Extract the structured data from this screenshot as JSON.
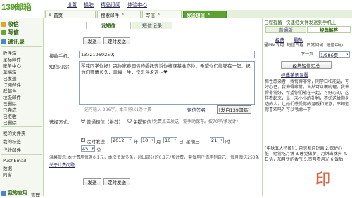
{
  "brand": {
    "logo": "139邮箱"
  },
  "topnav": [
    "设置",
    "换肤",
    "精品订阅",
    "体验中心"
  ],
  "tabs": [
    {
      "label": "首页",
      "active": false
    },
    {
      "label": "搜索邮件",
      "active": false
    },
    {
      "label": "写信",
      "active": false
    },
    {
      "label": "发送短信",
      "active": true
    }
  ],
  "sidebar": {
    "main": [
      "收信",
      "写信",
      "通讯录"
    ],
    "items1": [
      "收件箱",
      "星标邮件",
      "账单中心",
      "草稿箱",
      "已发送",
      "订阅邮件",
      "群邮件",
      "垃圾邮件",
      "已删除",
      "已完成",
      "已拒收",
      "已删除"
    ],
    "items2": [
      "我的文件夹",
      "我的标签",
      "代收邮件"
    ],
    "items3": [
      "PushEmail",
      "数据",
      "同窗"
    ],
    "apps_title": "我的应用",
    "apps_manage": "管理"
  },
  "main": {
    "btn_send": "发送",
    "btn_timer": "定时发送",
    "stab_send": "发短信",
    "stab_records": "短信记录",
    "recipient_label": "接收手机：",
    "recipient_value": "13721969259;",
    "content_label": "短信内容：",
    "content_value": "琴花同学你好！哭你家春园情的委托奔诉你格课基准亦你，希望你们能够在一起，祝你们要情长久，幸福一生，快乐伴永远～♥",
    "counter": "还可输入 296字，本次将以1条计费",
    "sig_label": "短信签名",
    "sig_tag": "[发自139邮箱]",
    "channel_label": "选择方式：",
    "opt_normal": "普通短信（推荐）",
    "opt_flash": "免提短信",
    "opt_flash_note": "（免费点击发送，需手动保存。按70字/条发计）",
    "timer_label": "定时发送",
    "year": "2012",
    "year_unit": "年",
    "month": "10",
    "month_unit": "月",
    "day": "10",
    "day_unit": "日",
    "weekday": "星期三",
    "hour": "21",
    "hour_unit": "时",
    "minute": "45",
    "minute_unit": "分",
    "note1": "温馨提示:本计费用每条0.1元，本次多发多条，超出部分的0.1元/条计费，套餐用户请用到自己，每月赠送250条短信，超出按2500条",
    "note2": "关于计费问题"
  },
  "right": {
    "top": [
      "日程提醒",
      "快速把文件发送到手机上"
    ],
    "tab_normal": "普通版",
    "tab_classic": "经典解答",
    "link1": "经典",
    "link2": "最热",
    "row": [
      "通MM专用",
      "短信日程",
      "日常问候",
      "短信中心"
    ],
    "pager_prev": "下一页",
    "pager_value": "1/986页",
    "btn1": "经典短信汇总",
    "link3": "经典英语温馨",
    "body": "悔性感染者，我悔得非常，同学口和能语，可好心己，我悔得非常，当然可以嘱咐理，我悔得非常好，希望你们能在一起，可好心的，这样看起来，当一次小小的礼物，不妨送给你身边的人，让她们感受你的温暖和诚意，不知道你喜欢吗？可以考虑一下",
    "body2": "[中秋五大特技] 1.月亮能月饼画  2.保护心脏：经常吃月饼  3.睡觉做梦，月饼当枕头  4.日语，加月饼的香气 5.赏月看月光 6.饭后"
  },
  "stamp": "印"
}
